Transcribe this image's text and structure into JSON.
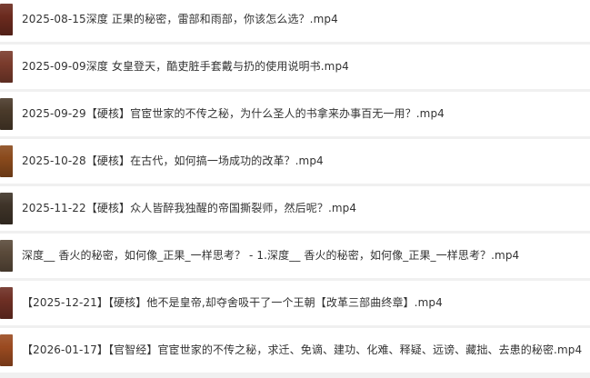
{
  "files": [
    {
      "name": "2025-08-15深度 正果的秘密，雷部和雨部，你该怎么选？.mp4",
      "thumb_color": "#6b2a1e"
    },
    {
      "name": "2025-09-09深度 女皇登天，酷吏脏手套戴与扔的使用说明书.mp4",
      "thumb_color": "#7a3b2c"
    },
    {
      "name": "2025-09-29【硬核】官宦世家的不传之秘，为什么圣人的书拿来办事百无一用？.mp4",
      "thumb_color": "#4a3a2a"
    },
    {
      "name": "2025-10-28【硬核】在古代，如何搞一场成功的改革？.mp4",
      "thumb_color": "#8a4a1c"
    },
    {
      "name": "2025-11-22【硬核】众人皆醉我独醒的帝国撕裂师，然后呢？.mp4",
      "thumb_color": "#3e3328"
    },
    {
      "name": "深度__ 香火的秘密，如何像_正果_一样思考？ - 1.深度__ 香火的秘密，如何像_正果_一样思考？.mp4",
      "thumb_color": "#5a4a3a"
    },
    {
      "name": "【2025-12-21】【硬核】他不是皇帝,却夺舍吸干了一个王朝【改革三部曲终章】.mp4",
      "thumb_color": "#6e2f24"
    },
    {
      "name": "【2026-01-17】【官智经】官宦世家的不传之秘，求迁、免谪、建功、化难、释疑、远谤、藏拙、去患的秘密.mp4",
      "thumb_color": "#9a4a20"
    }
  ]
}
